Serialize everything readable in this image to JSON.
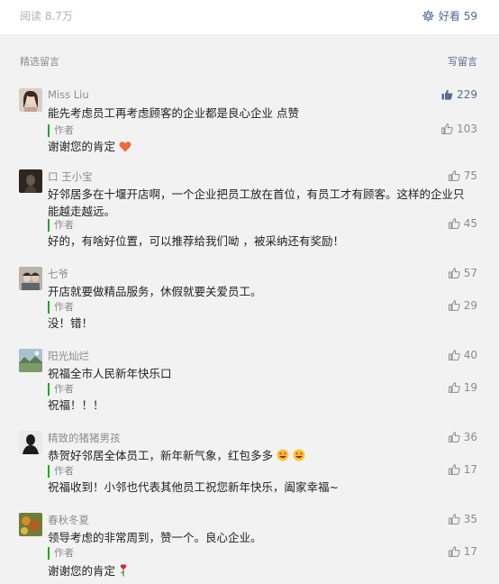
{
  "header": {
    "read_count": "阅读 8.7万",
    "like_label": "好看 59"
  },
  "section": {
    "title": "精选留言",
    "write_label": "写留言"
  },
  "comments": [
    {
      "nickname": "Miss Liu",
      "likes": "229",
      "liked": true,
      "text": "能先考虑员工再考虑顾客的企业都是良心企业 点赞",
      "author_label": "作者",
      "reply_likes": "103",
      "reply": "谢谢您的肯定"
    },
    {
      "nickname": "口 王小宝",
      "likes": "75",
      "liked": false,
      "text": "好邻居多在十堰开店啊，一个企业把员工放在首位，有员工才有顾客。这样的企业只能越走越远。",
      "author_label": "作者",
      "reply_likes": "45",
      "reply": "好的，有啥好位置，可以推荐给我们呦 ，被采纳还有奖励！"
    },
    {
      "nickname": "七爷",
      "likes": "57",
      "liked": false,
      "text": "开店就要做精品服务，休假就要关爱员工。",
      "author_label": "作者",
      "reply_likes": "29",
      "reply": "没！错！"
    },
    {
      "nickname": "阳光灿烂",
      "likes": "40",
      "liked": false,
      "text": "祝福全市人民新年快乐口",
      "author_label": "作者",
      "reply_likes": "19",
      "reply": "祝福！！！"
    },
    {
      "nickname": "精致的猪猪男孩",
      "likes": "36",
      "liked": false,
      "text": "恭贺好邻居全体员工，新年新气象，红包多多",
      "author_label": "作者",
      "reply_likes": "17",
      "reply": "祝福收到！小邻也代表其他员工祝您新年快乐，阖家幸福~"
    },
    {
      "nickname": "春秋冬夏",
      "likes": "35",
      "liked": false,
      "text": "领导考虑的非常周到，赞一个。良心企业。",
      "author_label": "作者",
      "reply_likes": "17",
      "reply": "谢谢您的肯定"
    }
  ],
  "colors": {
    "accent": "#576b95",
    "author_bar": "#1aad19",
    "muted": "#8c8c8c"
  }
}
